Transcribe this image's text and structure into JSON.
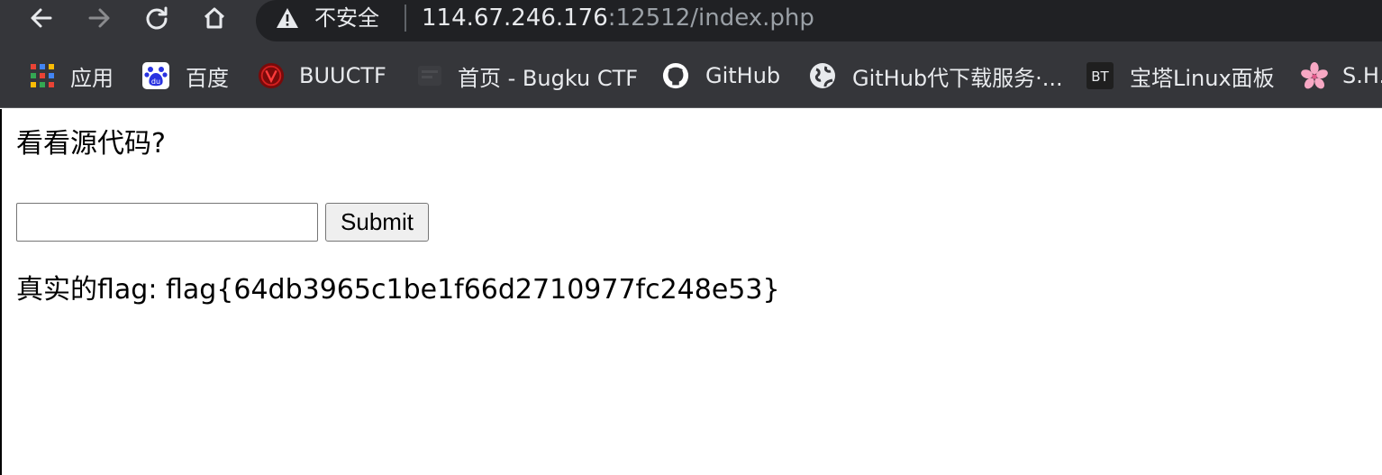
{
  "browser": {
    "omnibox": {
      "security_label": "不安全",
      "url_host": "114.67.246.176",
      "url_rest": ":12512/index.php"
    },
    "bookmarks": [
      {
        "label": "应用",
        "icon": "apps-grid-icon"
      },
      {
        "label": "百度",
        "icon": "baidu-paw-icon"
      },
      {
        "label": "BUUCTF",
        "icon": "buuctf-logo-icon"
      },
      {
        "label": "首页 - Bugku CTF",
        "icon": "bugku-favicon-icon"
      },
      {
        "label": "GitHub",
        "icon": "github-octocat-icon"
      },
      {
        "label": "GitHub代下载服务·...",
        "icon": "globe-icon"
      },
      {
        "label": "宝塔Linux面板",
        "icon": "bt-panel-icon",
        "badge": "BT"
      },
      {
        "label": "S.H.",
        "icon": "sakura-flower-icon"
      }
    ]
  },
  "page": {
    "hint": "看看源代码?",
    "input": {
      "value": ""
    },
    "submit_label": "Submit",
    "flag_label": "真实的flag: flag{64db3965c1be1f66d2710977fc248e53}"
  }
}
